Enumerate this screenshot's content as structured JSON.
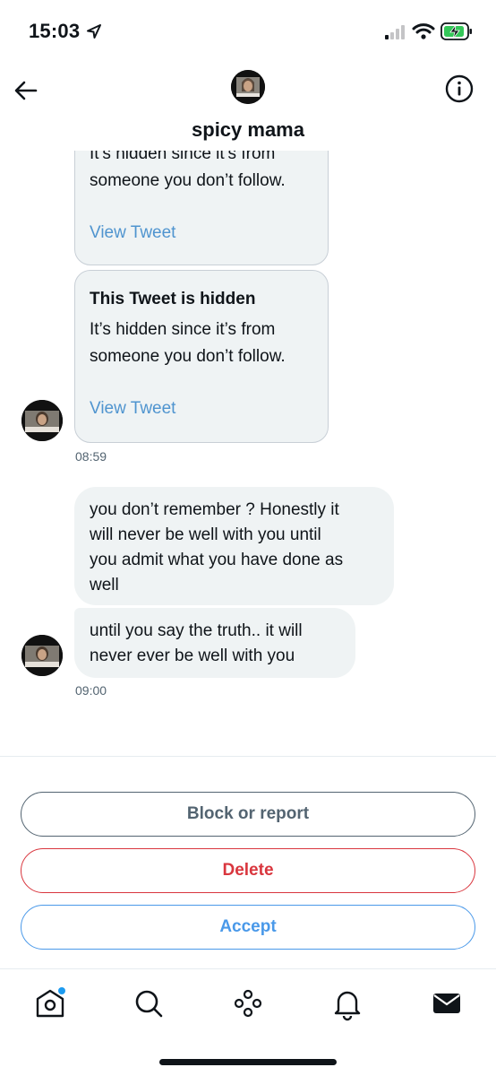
{
  "status_bar": {
    "time": "15:03",
    "icons": [
      "location-arrow-icon",
      "signal-icon",
      "wifi-icon",
      "battery-charging-icon"
    ]
  },
  "header": {
    "contact_name": "spicy mama",
    "back_icon": "arrow-left-icon",
    "info_icon": "info-circle-icon"
  },
  "messages": {
    "card1": {
      "body_partial": "It’s hidden since it’s from",
      "body_line2": "someone you don’t follow.",
      "link": "View Tweet"
    },
    "card2": {
      "title": "This Tweet is hidden",
      "body_line1": "It’s hidden since it’s from",
      "body_line2": "someone you don’t follow.",
      "link": "View Tweet"
    },
    "time1": "08:59",
    "bubble1": [
      "you don’t remember ? Honestly it",
      "will never be well with you until",
      "you admit what you have done as",
      "well"
    ],
    "bubble2": [
      "until you say the truth.. it will",
      "never ever be well with you"
    ],
    "time2": "09:00"
  },
  "actions": {
    "block": "Block or report",
    "delete": "Delete",
    "accept": "Accept"
  },
  "colors": {
    "accent_blue": "#4a99e9",
    "delete_red": "#d9363e",
    "muted_gray": "#536471",
    "bubble_bg": "#eff3f4",
    "notification_dot": "#1d9bf0"
  },
  "tabbar": {
    "tabs": [
      "home-icon",
      "search-icon",
      "spaces-icon",
      "bell-icon",
      "envelope-icon"
    ]
  }
}
